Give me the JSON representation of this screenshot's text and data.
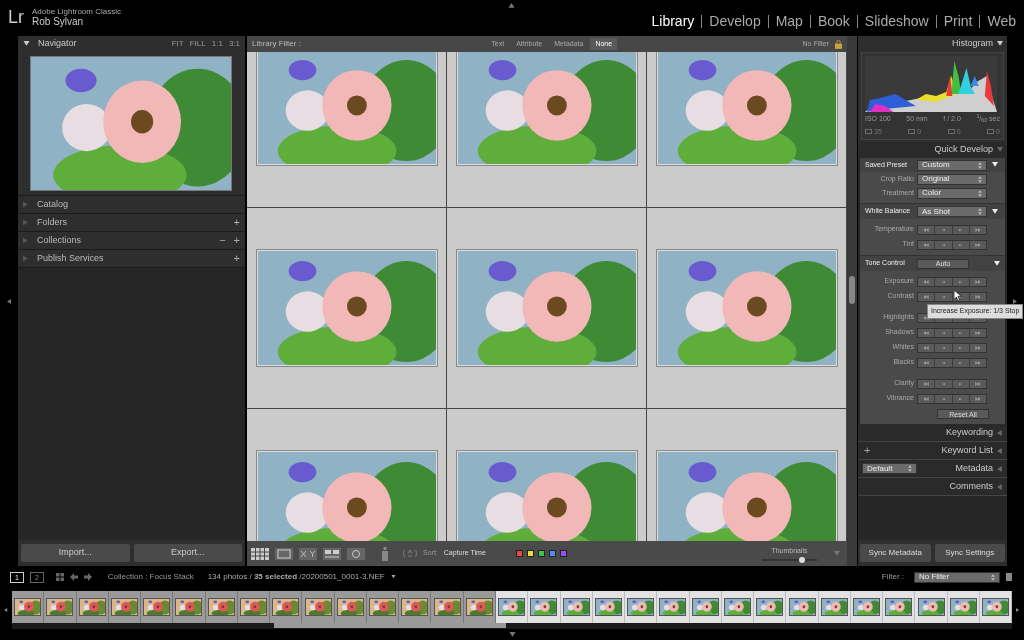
{
  "app": {
    "logo": "Lr",
    "product": "Adobe Lightroom Classic",
    "user": "Rob Sylvan"
  },
  "modules": [
    {
      "label": "Library",
      "selected": true
    },
    {
      "label": "Develop",
      "selected": false
    },
    {
      "label": "Map",
      "selected": false
    },
    {
      "label": "Book",
      "selected": false
    },
    {
      "label": "Slideshow",
      "selected": false
    },
    {
      "label": "Print",
      "selected": false
    },
    {
      "label": "Web",
      "selected": false
    }
  ],
  "navigator": {
    "title": "Navigator",
    "zoom_options": [
      "FIT",
      "FILL",
      "1:1",
      "3:1"
    ]
  },
  "left_panels": [
    {
      "title": "Catalog"
    },
    {
      "title": "Folders",
      "actions": [
        "+"
      ]
    },
    {
      "title": "Collections",
      "actions": [
        "−",
        "+"
      ]
    },
    {
      "title": "Publish Services",
      "actions": [
        "+"
      ]
    }
  ],
  "left_buttons": [
    "Import...",
    "Export..."
  ],
  "library_filter": {
    "label": "Library Filter :",
    "tabs": [
      {
        "label": "Text",
        "selected": false
      },
      {
        "label": "Attribute",
        "selected": false
      },
      {
        "label": "Metadata",
        "selected": false
      },
      {
        "label": "None",
        "selected": true
      }
    ],
    "preset": "No Filter"
  },
  "toolbar": {
    "sort_label": "Sort:",
    "sort_value": "Capture Time",
    "color_labels": [
      {
        "color": "#e8474a"
      },
      {
        "color": "#e6e033"
      },
      {
        "color": "#3fc04a"
      },
      {
        "color": "#4c8ff0"
      },
      {
        "color": "#9a4ff0"
      }
    ],
    "thumbnails": {
      "label": "Thumbnails",
      "level": 0.72
    }
  },
  "histogram": {
    "title": "Histogram",
    "info": [
      "ISO 100",
      "50 mm",
      "f / 2.0",
      "$^{1}$/$_{60}$ sec"
    ],
    "counts": [
      "35",
      "0",
      "0",
      "0"
    ]
  },
  "quick_develop": {
    "title": "Quick Develop",
    "saved_preset": {
      "label": "Saved Preset",
      "value": "Custom"
    },
    "settings": [
      {
        "label": "Crop Ratio",
        "value": "Original"
      },
      {
        "label": "Treatment",
        "value": "Color"
      }
    ],
    "white_balance": {
      "label": "White Balance",
      "value": "As Shot"
    },
    "wb_sliders": [
      "Temperature",
      "Tint"
    ],
    "tone_control": {
      "label": "Tone Control",
      "button": "Auto"
    },
    "tone_groups": [
      [
        "Exposure",
        "Contrast"
      ],
      [
        "Highlights",
        "Shadows",
        "Whites",
        "Blacks"
      ],
      [
        "Clarity",
        "Vibrance"
      ]
    ],
    "reset": "Reset All"
  },
  "tooltip": "Increase Exposure: 1/3 Stop",
  "right_panels": [
    {
      "title": "Keywording"
    },
    {
      "title": "Keyword List",
      "action": "+"
    },
    {
      "title": "Metadata",
      "preset": "Default"
    },
    {
      "title": "Comments"
    }
  ],
  "sync_buttons": [
    "Sync Metadata",
    "Sync Settings"
  ],
  "filmstrip": {
    "monitors": [
      {
        "label": "1",
        "selected": true
      },
      {
        "label": "2",
        "selected": false
      }
    ],
    "source": "Collection : Focus Stack",
    "status": "134 photos / **35 selected** /20200501_0001-3.NEF",
    "filter_label": "Filter :",
    "filter_value": "No Filter",
    "thumbs": [
      {
        "selected": false
      },
      {
        "selected": false
      },
      {
        "selected": false
      },
      {
        "selected": false
      },
      {
        "selected": false
      },
      {
        "selected": false
      },
      {
        "selected": false
      },
      {
        "selected": false
      },
      {
        "selected": false
      },
      {
        "selected": false
      },
      {
        "selected": false
      },
      {
        "selected": false
      },
      {
        "selected": false
      },
      {
        "selected": false
      },
      {
        "selected": false
      },
      {
        "selected": true
      },
      {
        "selected": true
      },
      {
        "selected": true
      },
      {
        "selected": true
      },
      {
        "selected": true
      },
      {
        "selected": true
      },
      {
        "selected": true
      },
      {
        "selected": true
      },
      {
        "selected": true
      },
      {
        "selected": true
      },
      {
        "selected": true
      },
      {
        "selected": true
      },
      {
        "selected": true
      },
      {
        "selected": true
      },
      {
        "selected": true
      },
      {
        "selected": true
      }
    ]
  }
}
